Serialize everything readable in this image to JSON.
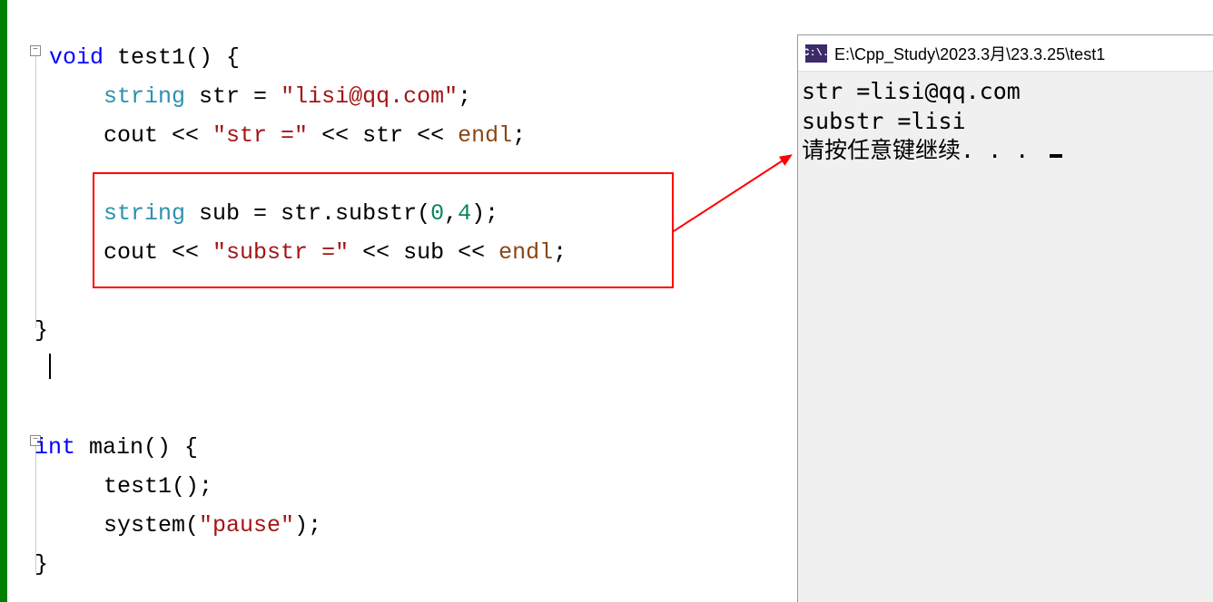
{
  "code": {
    "line1": {
      "void": "void",
      "name": " test1() {"
    },
    "line2": {
      "indent": "    ",
      "type": "string",
      "rest1": " str = ",
      "str": "\"lisi@qq.com\"",
      "rest2": ";"
    },
    "line3": {
      "indent": "    ",
      "cout": "cout << ",
      "str": "\"str =\"",
      "rest": " << str << ",
      "endl": "endl",
      "semi": ";"
    },
    "line5": {
      "indent": "    ",
      "type": "string",
      "rest1": " sub = str.substr(",
      "n1": "0",
      "comma": ",",
      "n2": "4",
      "rest2": ");"
    },
    "line6": {
      "indent": "    ",
      "cout": "cout << ",
      "str": "\"substr =\"",
      "rest": " << sub << ",
      "endl": "endl",
      "semi": ";"
    },
    "line8": {
      "brace": "}"
    },
    "line10": {
      "int": "int",
      "name": " main() {"
    },
    "line11": {
      "indent": "    ",
      "call": "test1();"
    },
    "line12": {
      "indent": "    ",
      "sys": "system(",
      "str": "\"pause\"",
      "rest": ");"
    },
    "line13": {
      "brace": "}"
    }
  },
  "console": {
    "icon_text": "C:\\.",
    "title": "E:\\Cpp_Study\\2023.3月\\23.3.25\\test1",
    "line1": "str =lisi@qq.com",
    "line2": "substr =lisi",
    "line3": "请按任意键继续. . . "
  }
}
